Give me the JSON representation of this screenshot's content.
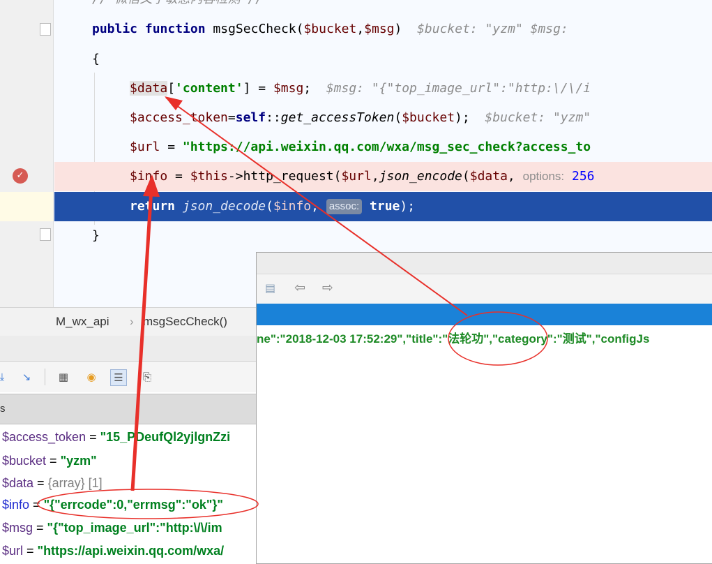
{
  "editor": {
    "comment_partial": "// 微信文字敏感内容检测 //",
    "line1": {
      "kw1": "public",
      "kw2": "function",
      "name": "msgSecCheck(",
      "p1": "$bucket",
      "comma": ",",
      "p2": "$msg",
      "close": ")",
      "hint": "$bucket: \"yzm\"  $msg:"
    },
    "brace_open": "{",
    "line3": {
      "var": "$data",
      "open": "[",
      "key": "'content'",
      "rest": "] = ",
      "msg": "$msg",
      "semi": ";",
      "hint": "$msg: \"{\"top_image_url\":\"http:\\/\\/i"
    },
    "line4": {
      "var": "$access_token",
      "eq": "=",
      "self": "self",
      "colons": "::",
      "fn": "get_accessToken",
      "open": "(",
      "arg": "$bucket",
      "close": ");",
      "hint": "$bucket: \"yzm\""
    },
    "line5": {
      "var": "$url",
      "eq": " = ",
      "str": "\"https://api.weixin.qq.com/wxa/msg_sec_check?access_to"
    },
    "line6": {
      "var": "$info",
      "eq": " = ",
      "this": "$this",
      "arrow": "->",
      "fn": "http_request(",
      "url": "$url",
      "comma": ",",
      "fn2": "json_encode",
      "open": "(",
      "data": "$data",
      "comma2": ",",
      "hint": "options:",
      "num": "256"
    },
    "line7": {
      "kw": "return",
      "fn": "json_decode",
      "open": "(",
      "var": "$info",
      "comma": ",",
      "pill": "assoc:",
      "val": "true",
      "close": ");"
    },
    "brace_close": "}"
  },
  "breadcrumb": {
    "class_name": "M_wx_api",
    "separator": "›",
    "method": "msgSecCheck()"
  },
  "debugger": {
    "panel_label": "s",
    "variables": [
      {
        "name": "$access_token",
        "value": "\"15_PDeufQl2yjlgnZzi",
        "kind": "string",
        "highlight": false
      },
      {
        "name": "$bucket",
        "value": "\"yzm\"",
        "kind": "string",
        "highlight": false
      },
      {
        "name": "$data",
        "value": "{array} [1]",
        "kind": "array",
        "highlight": false
      },
      {
        "name": "$info",
        "value": "\"{\"errcode\":0,\"errmsg\":\"ok\"}\"",
        "kind": "string",
        "highlight": true
      },
      {
        "name": "$msg",
        "value": "\"{\"top_image_url\":\"http:\\/\\/im",
        "kind": "string",
        "highlight": false
      },
      {
        "name": "$url",
        "value": "\"https://api.weixin.qq.com/wxa/",
        "kind": "string",
        "highlight": false
      }
    ]
  },
  "popup": {
    "json_text_1": "ne\":\"2018-12-03 17:52:29\",\"title\":\"",
    "json_title": "法轮功",
    "json_text_2": "\",\"category\":\"测试\",\"configJs"
  },
  "colors": {
    "annotation": "#e8302a",
    "exec_line": "#2150a8",
    "breakpoint_line": "#fbe3e0",
    "string_green": "#008000"
  },
  "icons": [
    "breakpoint-icon",
    "fold-icon",
    "back-arrow-icon",
    "forward-arrow-icon",
    "step-icon",
    "calculator-icon",
    "watch-icon",
    "settings-icon"
  ]
}
